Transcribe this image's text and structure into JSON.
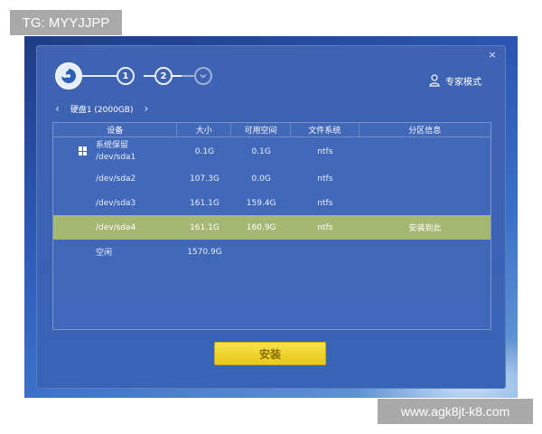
{
  "watermark_top": "TG: MYYJJPP",
  "watermark_bottom": "www.agk8jt-k8.com",
  "installer": {
    "close_glyph": "×",
    "stepper": {
      "steps": [
        {
          "label": "1"
        },
        {
          "label": "2"
        }
      ],
      "logo_icon": "swirl-logo-icon",
      "done_icon": "check-circle-icon"
    },
    "expert_mode": {
      "label": "专家模式",
      "icon": "user-icon"
    },
    "disk_nav": {
      "label": "硬盘1 (2000GB)",
      "prev_glyph": "‹",
      "next_glyph": "›"
    },
    "table": {
      "headers": [
        "设备",
        "大小",
        "可用空间",
        "文件系统",
        "分区信息"
      ],
      "rows": [
        {
          "device_line1": "系统保留",
          "device_line2": "/dev/sda1",
          "size": "0.1G",
          "free": "0.1G",
          "fs": "ntfs",
          "info": "",
          "icon": "windows-icon",
          "selected": false
        },
        {
          "device": "/dev/sda2",
          "size": "107.3G",
          "free": "0.0G",
          "fs": "ntfs",
          "info": "",
          "selected": false
        },
        {
          "device": "/dev/sda3",
          "size": "161.1G",
          "free": "159.4G",
          "fs": "ntfs",
          "info": "",
          "selected": false
        },
        {
          "device": "/dev/sda4",
          "size": "161.1G",
          "free": "160.9G",
          "fs": "ntfs",
          "info": "安装到此",
          "selected": true
        },
        {
          "device": "空闲",
          "size": "1570.9G",
          "free": "",
          "fs": "",
          "info": "",
          "selected": false
        }
      ]
    },
    "install_button": {
      "label": "安装"
    },
    "colors": {
      "selected_row": "#a6b773",
      "install_button": "#f2d534",
      "dialog_bg": "#3f63b2"
    }
  }
}
